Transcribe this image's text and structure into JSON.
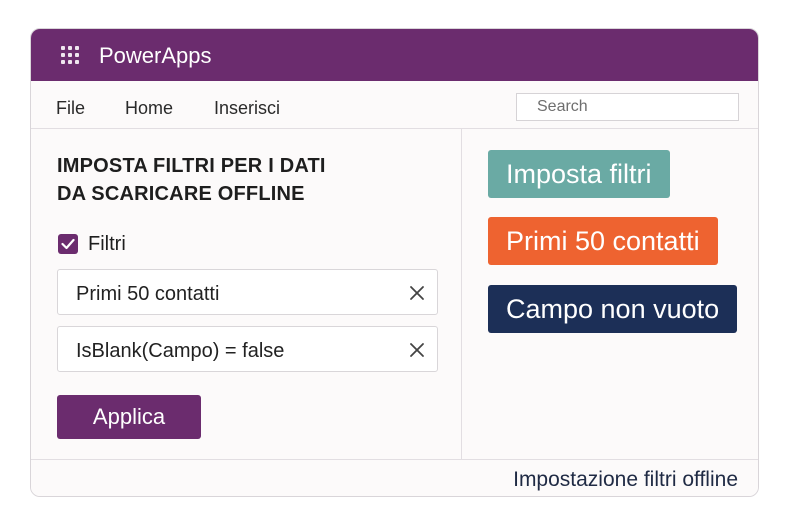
{
  "app": {
    "title": "PowerApps",
    "icon": "waffle-icon",
    "accent": "#6b2c6e"
  },
  "menu": {
    "items": [
      "File",
      "Home",
      "Inserisci"
    ]
  },
  "search": {
    "placeholder": "Search",
    "value": ""
  },
  "panel": {
    "heading_line1": "IMPOSTA FILTRI PER I DATI",
    "heading_line2": "DA SCARICARE OFFLINE",
    "checkbox_label": "Filtri",
    "checkbox_checked": true,
    "filters": [
      {
        "text": "Primi 50 contatti",
        "remove_icon": "close-icon"
      },
      {
        "text": "IsBlank(Campo) = false",
        "remove_icon": "close-icon"
      }
    ],
    "apply_label": "Applica"
  },
  "tags": [
    {
      "label": "Imposta filtri",
      "color": "#6aaaa4"
    },
    {
      "label": "Primi 50 contatti",
      "color": "#ee6330"
    },
    {
      "label": "Campo non vuoto",
      "color": "#1c2f57"
    }
  ],
  "footer": {
    "text": "Impostazione filtri offline"
  }
}
